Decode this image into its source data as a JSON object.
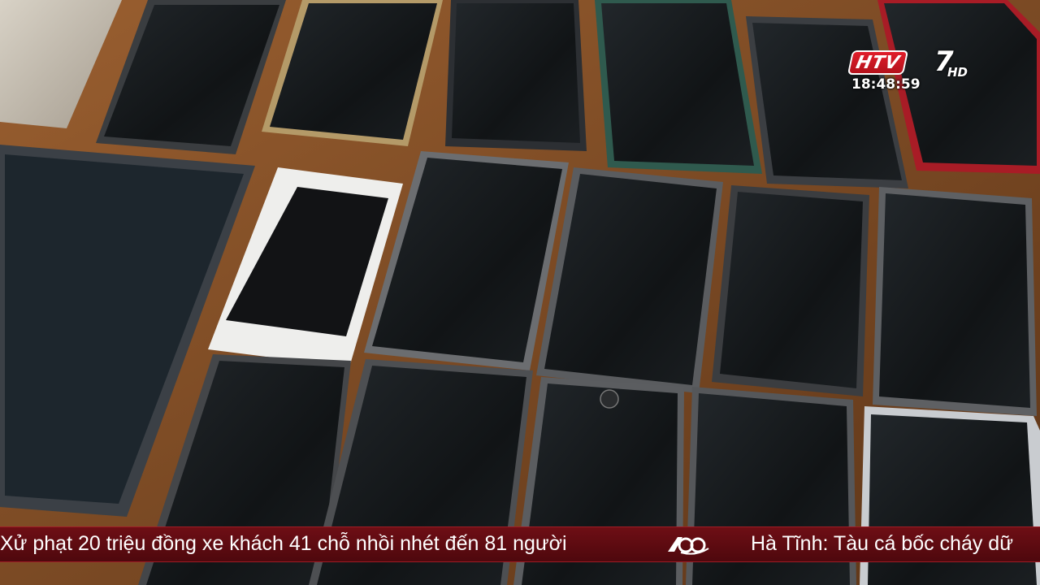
{
  "broadcast": {
    "channel": {
      "name_letters": "HTV",
      "number": "7",
      "quality": "HD"
    },
    "clock": "18:48:59"
  },
  "ticker": {
    "items": [
      "Xử phạt 20 triệu đồng xe khách 41 chỗ nhồi nhét đến 81 người",
      "Hà Tĩnh: Tàu cá bốc cháy dữ"
    ],
    "separator_icon": "60-years-emblem-icon"
  },
  "scene": {
    "subject": "seized phones and tablets on wooden table",
    "colors": {
      "table": "#7a4a26",
      "screen": "#121416",
      "ticker": "#5e0b12",
      "logo_red": "#e11d2a"
    }
  }
}
